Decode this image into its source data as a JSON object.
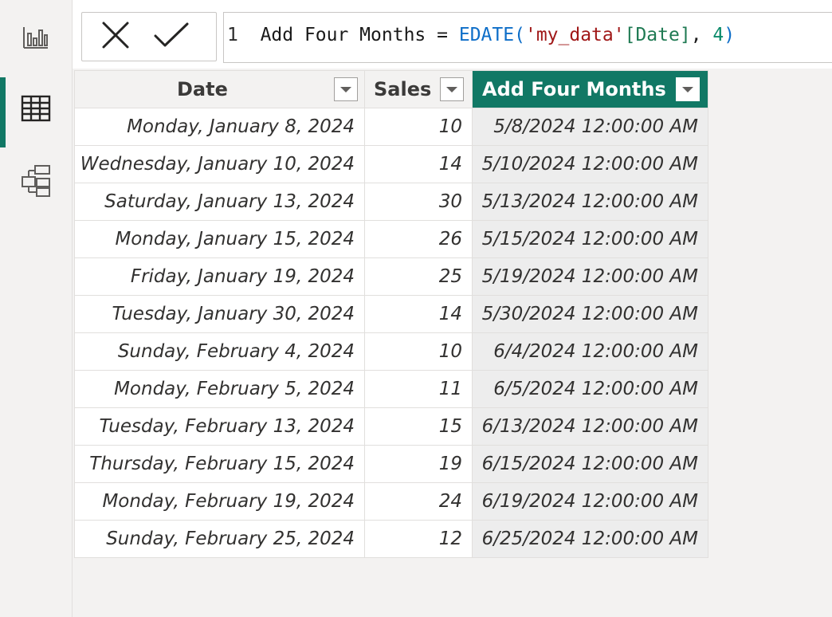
{
  "formula": {
    "line_number": "1",
    "measure_name": "Add Four Months",
    "equals": "=",
    "function": "EDATE",
    "open_paren": "(",
    "table_ref": "'my_data'",
    "column_ref": "[Date]",
    "separator": ",",
    "number_arg": "4",
    "close_paren": ")"
  },
  "toolbar": {
    "cancel_icon": "close-icon",
    "commit_icon": "checkmark-icon"
  },
  "rail": {
    "items": [
      {
        "icon": "report-view-icon"
      },
      {
        "icon": "table-view-icon",
        "active": true
      },
      {
        "icon": "model-view-icon"
      }
    ]
  },
  "accent_color": "#117865",
  "table": {
    "columns": [
      "Date",
      "Sales",
      "Add Four Months"
    ],
    "rows": [
      [
        "Monday, January 8, 2024",
        "10",
        "5/8/2024 12:00:00 AM"
      ],
      [
        "Wednesday, January 10, 2024",
        "14",
        "5/10/2024 12:00:00 AM"
      ],
      [
        "Saturday, January 13, 2024",
        "30",
        "5/13/2024 12:00:00 AM"
      ],
      [
        "Monday, January 15, 2024",
        "26",
        "5/15/2024 12:00:00 AM"
      ],
      [
        "Friday, January 19, 2024",
        "25",
        "5/19/2024 12:00:00 AM"
      ],
      [
        "Tuesday, January 30, 2024",
        "14",
        "5/30/2024 12:00:00 AM"
      ],
      [
        "Sunday, February 4, 2024",
        "10",
        "6/4/2024 12:00:00 AM"
      ],
      [
        "Monday, February 5, 2024",
        "11",
        "6/5/2024 12:00:00 AM"
      ],
      [
        "Tuesday, February 13, 2024",
        "15",
        "6/13/2024 12:00:00 AM"
      ],
      [
        "Thursday, February 15, 2024",
        "19",
        "6/15/2024 12:00:00 AM"
      ],
      [
        "Monday, February 19, 2024",
        "24",
        "6/19/2024 12:00:00 AM"
      ],
      [
        "Sunday, February 25, 2024",
        "12",
        "6/25/2024 12:00:00 AM"
      ]
    ]
  }
}
